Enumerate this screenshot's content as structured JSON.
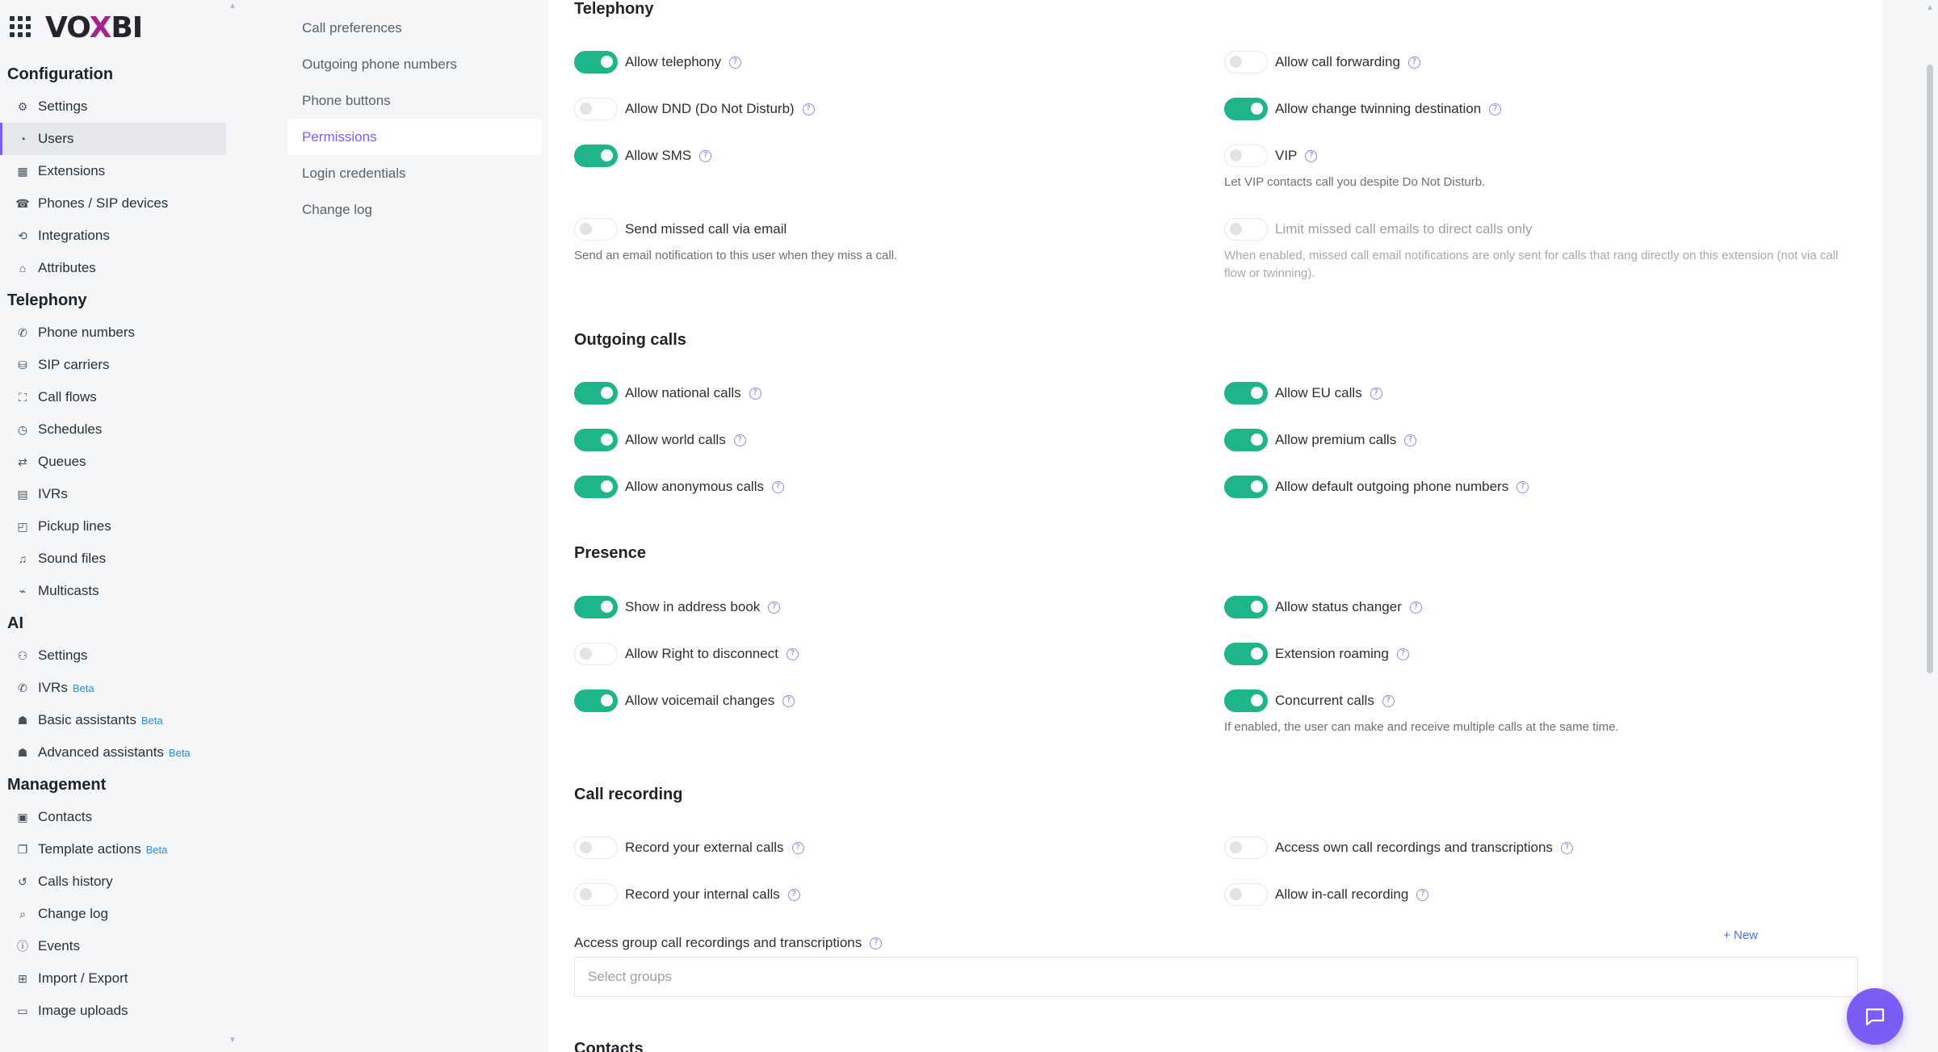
{
  "brand": {
    "prefix": "VO",
    "x": "X",
    "suffix": "BI"
  },
  "sidebar": {
    "groups": [
      {
        "title": "Configuration",
        "items": [
          {
            "label": "Settings",
            "icon": "gear-icon"
          },
          {
            "label": "Users",
            "icon": "user-icon",
            "active": true
          },
          {
            "label": "Extensions",
            "icon": "extensions-icon"
          },
          {
            "label": "Phones / SIP devices",
            "icon": "phone-device-icon"
          },
          {
            "label": "Integrations",
            "icon": "integrations-icon"
          },
          {
            "label": "Attributes",
            "icon": "attributes-icon"
          }
        ]
      },
      {
        "title": "Telephony",
        "items": [
          {
            "label": "Phone numbers",
            "icon": "phone-icon"
          },
          {
            "label": "SIP carriers",
            "icon": "sip-carrier-icon"
          },
          {
            "label": "Call flows",
            "icon": "call-flow-icon"
          },
          {
            "label": "Schedules",
            "icon": "clock-icon"
          },
          {
            "label": "Queues",
            "icon": "queue-icon"
          },
          {
            "label": "IVRs",
            "icon": "ivr-icon"
          },
          {
            "label": "Pickup lines",
            "icon": "pickup-icon"
          },
          {
            "label": "Sound files",
            "icon": "music-note-icon"
          },
          {
            "label": "Multicasts",
            "icon": "broadcast-icon"
          }
        ]
      },
      {
        "title": "AI",
        "items": [
          {
            "label": "Settings",
            "icon": "ai-settings-icon"
          },
          {
            "label": "IVRs",
            "icon": "ai-ivr-icon",
            "badge": "Beta"
          },
          {
            "label": "Basic assistants",
            "icon": "robot-icon",
            "badge": "Beta"
          },
          {
            "label": "Advanced assistants",
            "icon": "robot-icon",
            "badge": "Beta"
          }
        ]
      },
      {
        "title": "Management",
        "items": [
          {
            "label": "Contacts",
            "icon": "contacts-icon"
          },
          {
            "label": "Template actions",
            "icon": "template-icon",
            "badge": "Beta"
          },
          {
            "label": "Calls history",
            "icon": "history-icon"
          },
          {
            "label": "Change log",
            "icon": "search-icon"
          },
          {
            "label": "Events",
            "icon": "info-icon"
          },
          {
            "label": "Import / Export",
            "icon": "import-export-icon"
          },
          {
            "label": "Image uploads",
            "icon": "image-icon"
          }
        ]
      }
    ]
  },
  "subnav": {
    "items": [
      {
        "label": "Call preferences"
      },
      {
        "label": "Outgoing phone numbers"
      },
      {
        "label": "Phone buttons"
      },
      {
        "label": "Permissions",
        "active": true
      },
      {
        "label": "Login credentials"
      },
      {
        "label": "Change log"
      }
    ]
  },
  "sections": {
    "telephony": {
      "title": "Telephony",
      "options": [
        {
          "label": "Allow telephony",
          "on": true
        },
        {
          "label": "Allow call forwarding",
          "on": false
        },
        {
          "label": "Allow DND (Do Not Disturb)",
          "on": false
        },
        {
          "label": "Allow change twinning destination",
          "on": true
        },
        {
          "label": "Allow SMS",
          "on": true
        },
        {
          "label": "VIP",
          "on": false,
          "description": "Let VIP contacts call you despite Do Not Disturb."
        },
        {
          "label": "Send missed call via email",
          "on": false,
          "description": "Send an email notification to this user when they miss a call."
        },
        {
          "label": "Limit missed call emails to direct calls only",
          "on": false,
          "disabled": true,
          "description": "When enabled, missed call email notifications are only sent for calls that rang directly on this extension (not via call flow or twinning)."
        }
      ]
    },
    "outgoing": {
      "title": "Outgoing calls",
      "options": [
        {
          "label": "Allow national calls",
          "on": true
        },
        {
          "label": "Allow EU calls",
          "on": true
        },
        {
          "label": "Allow world calls",
          "on": true
        },
        {
          "label": "Allow premium calls",
          "on": true
        },
        {
          "label": "Allow anonymous calls",
          "on": true
        },
        {
          "label": "Allow default outgoing phone numbers",
          "on": true
        }
      ]
    },
    "presence": {
      "title": "Presence",
      "options": [
        {
          "label": "Show in address book",
          "on": true
        },
        {
          "label": "Allow status changer",
          "on": true
        },
        {
          "label": "Allow Right to disconnect",
          "on": false
        },
        {
          "label": "Extension roaming",
          "on": true
        },
        {
          "label": "Allow voicemail changes",
          "on": true
        },
        {
          "label": "Concurrent calls",
          "on": true,
          "description": "If enabled, the user can make and receive multiple calls at the same time."
        }
      ]
    },
    "recording": {
      "title": "Call recording",
      "options": [
        {
          "label": "Record your external calls",
          "on": false
        },
        {
          "label": "Access own call recordings and transcriptions",
          "on": false
        },
        {
          "label": "Record your internal calls",
          "on": false
        },
        {
          "label": "Allow in-call recording",
          "on": false
        }
      ],
      "group_field_label": "Access group call recordings and transcriptions",
      "new_label": "+ New",
      "select_placeholder": "Select groups"
    },
    "contacts": {
      "title": "Contacts"
    }
  },
  "help_glyph": "?",
  "colors": {
    "accent": "#7c5cf5",
    "toggle_on": "#1fb58a",
    "chat_button": "#7b5cf4"
  }
}
